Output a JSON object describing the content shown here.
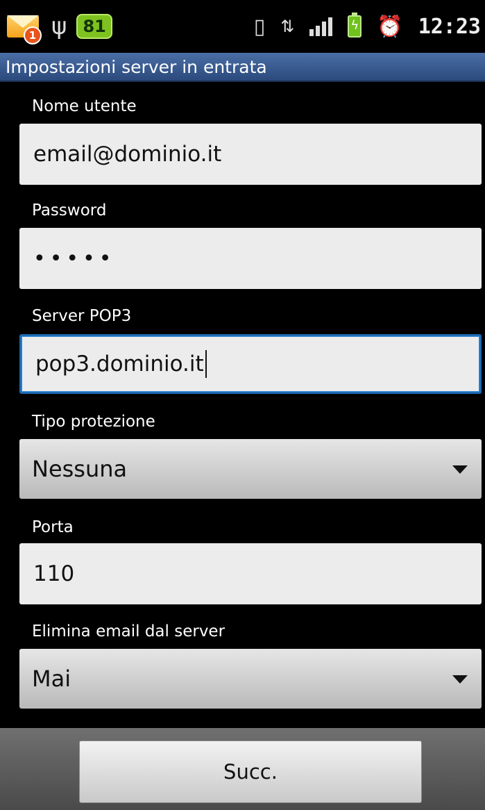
{
  "status_bar": {
    "notification_count": "1",
    "temperature": "81",
    "time": "12:23",
    "icons": [
      "mail-icon",
      "usb-icon",
      "vibrate-icon",
      "data-transfer-icon",
      "signal-icon",
      "battery-charging-icon",
      "alarm-icon"
    ]
  },
  "header": {
    "title": "Impostazioni server in entrata"
  },
  "form": {
    "username": {
      "label": "Nome utente",
      "value": "email@dominio.it"
    },
    "password": {
      "label": "Password",
      "value": "•••••"
    },
    "server": {
      "label": "Server POP3",
      "value": "pop3.dominio.it"
    },
    "security": {
      "label": "Tipo protezione",
      "value": "Nessuna"
    },
    "port": {
      "label": "Porta",
      "value": "110"
    },
    "delete": {
      "label": "Elimina email dal server",
      "value": "Mai"
    }
  },
  "footer": {
    "next_label": "Succ."
  },
  "colors": {
    "title_bar": "#3a5d93",
    "focus_border": "#1d6ab3",
    "battery": "#6fc21d"
  }
}
